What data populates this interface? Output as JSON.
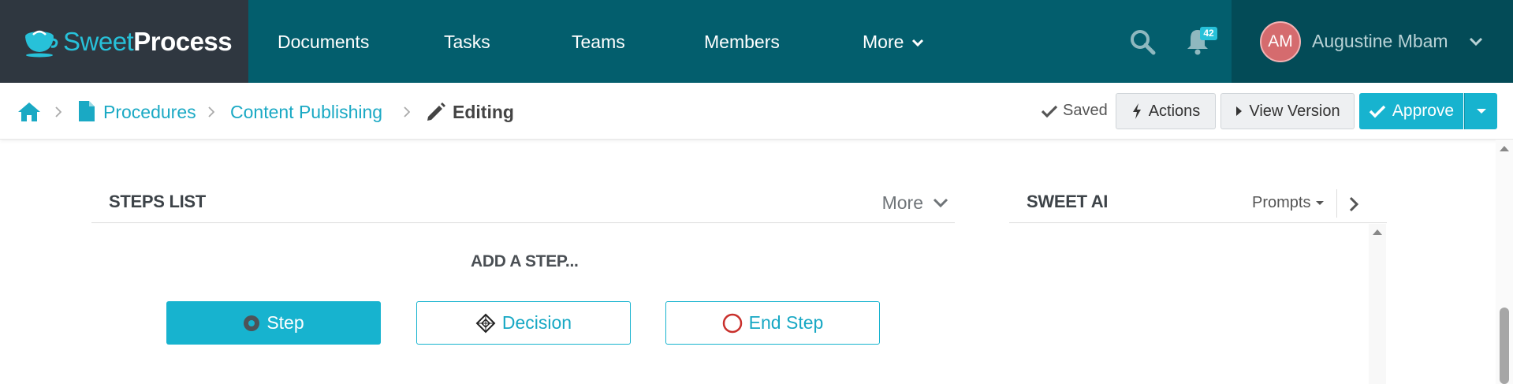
{
  "brand": {
    "sweet": "Sweet",
    "process": "Process"
  },
  "nav": {
    "items": [
      "Documents",
      "Tasks",
      "Teams",
      "Members",
      "More"
    ],
    "notification_count": "42"
  },
  "user": {
    "initials": "AM",
    "name": "Augustine Mbam"
  },
  "breadcrumb": {
    "procedures": "Procedures",
    "document": "Content Publishing",
    "current": "Editing"
  },
  "toolbar": {
    "saved": "Saved",
    "actions": "Actions",
    "view_version": "View Version",
    "approve": "Approve"
  },
  "steps_list": {
    "title": "STEPS LIST",
    "more": "More",
    "add_step": "ADD A STEP...",
    "buttons": {
      "step": "Step",
      "decision": "Decision",
      "end_step": "End Step"
    }
  },
  "sweet_ai": {
    "title": "SWEET AI",
    "prompts": "Prompts"
  },
  "colors": {
    "brand_dark": "#2f3740",
    "nav_bg": "#035e6d",
    "user_bg": "#034b57",
    "accent": "#17b3cf",
    "link": "#1aa9c4",
    "avatar": "#d56b6e",
    "end_icon": "#c9302c"
  },
  "icons": {
    "brand": "teacup-logo-icon",
    "search": "search-icon",
    "bell": "bell-icon",
    "home": "home-icon",
    "document": "document-icon",
    "pencil": "pencil-icon",
    "check": "check-icon",
    "bolt": "bolt-icon",
    "play": "play-icon"
  }
}
